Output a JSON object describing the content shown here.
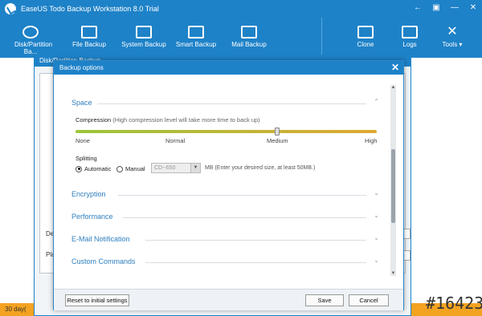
{
  "window": {
    "title": "EaseUS Todo Backup Workstation 8.0 Trial",
    "controls": [
      "←",
      "▣",
      "—",
      "✕"
    ]
  },
  "toolbar": {
    "items": [
      {
        "label": "Disk/Partition Ba...",
        "icon": "disk-icon"
      },
      {
        "label": "File Backup",
        "icon": "folder-icon"
      },
      {
        "label": "System Backup",
        "icon": "windows-icon"
      },
      {
        "label": "Smart Backup",
        "icon": "smart-icon"
      },
      {
        "label": "Mail Backup",
        "icon": "mail-icon"
      },
      {
        "label": "Clone",
        "icon": "clone-icon"
      },
      {
        "label": "Logs",
        "icon": "logs-icon"
      },
      {
        "label": "Tools ▾",
        "icon": "tools-icon"
      }
    ]
  },
  "background_dialog": {
    "title": "Disk/Partition Backup",
    "row_labels": [
      "De",
      "Pla"
    ]
  },
  "status": {
    "text": "30 day("
  },
  "dialog": {
    "title": "Backup options",
    "close": "✕",
    "sections": {
      "space": "Space",
      "encryption": "Encryption",
      "performance": "Performance",
      "email": "E-Mail Notification",
      "custom": "Custom Commands"
    },
    "compression": {
      "label": "Compression",
      "hint": "(High compression level will take more time to back up)",
      "levels": [
        "None",
        "Normal",
        "Medium",
        "High"
      ],
      "selected": "Medium"
    },
    "splitting": {
      "label": "Splitting",
      "automatic": "Automatic",
      "manual": "Manual",
      "selected": "Automatic",
      "size_value": "CD--650",
      "size_hint": "MB (Enter your desired size, at least 50MB.)"
    },
    "buttons": {
      "reset": "Reset to initial settings",
      "save": "Save",
      "cancel": "Cancel"
    }
  },
  "watermark": "#16423",
  "colors": {
    "accent": "#1e82c8",
    "slider_start": "#9bc63b",
    "slider_end": "#e0a832",
    "status": "#f4a321"
  }
}
